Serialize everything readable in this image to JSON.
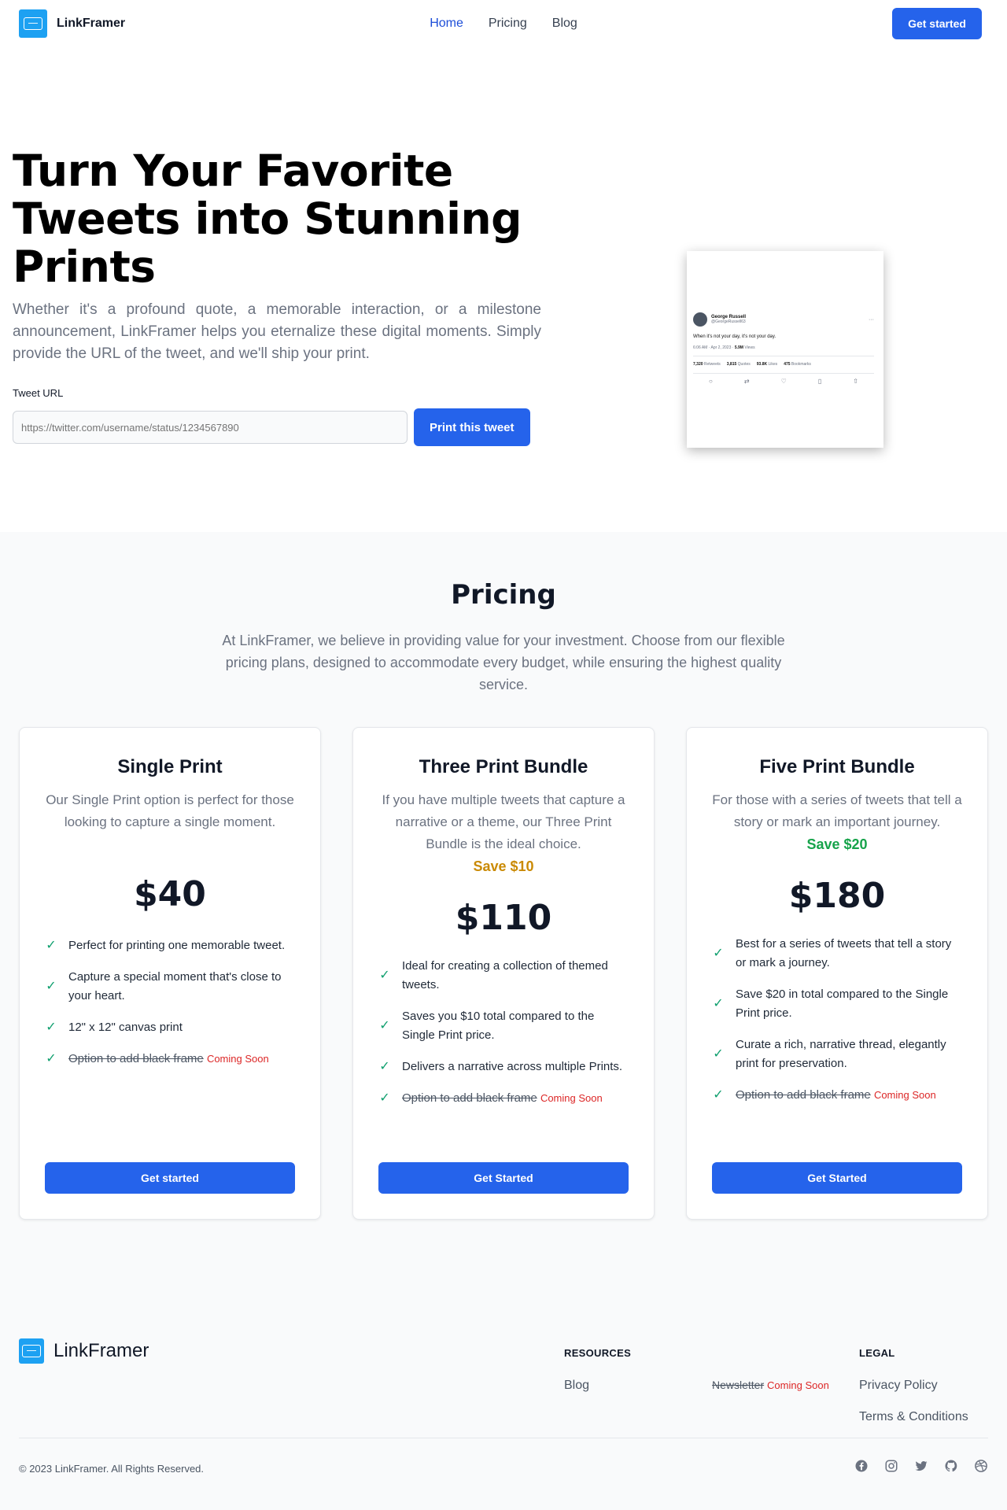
{
  "nav": {
    "brand": "LinkFramer",
    "links": [
      "Home",
      "Pricing",
      "Blog"
    ],
    "cta": "Get started"
  },
  "hero": {
    "title": "Turn Your Favorite Tweets into Stunning Prints",
    "description": "Whether it's a profound quote, a memorable interaction, or a milestone announcement, LinkFramer helps you eternalize these digital moments. Simply provide the URL of the tweet, and we'll ship your print.",
    "url_label": "Tweet URL",
    "url_placeholder": "https://twitter.com/username/status/1234567890",
    "button": "Print this tweet"
  },
  "tweet": {
    "name": "George Russell",
    "handle": "@GeorgeRussell63",
    "text": "When it's not your day, it's not your day.",
    "time": "6:06 AM · Apr 2, 2023 · ",
    "views_num": "5.9M",
    "views_label": " Views",
    "stats": [
      {
        "num": "7,320",
        "label": " Retweets"
      },
      {
        "num": "3,815",
        "label": " Quotes"
      },
      {
        "num": "93.8K",
        "label": " Likes"
      },
      {
        "num": "475",
        "label": " Bookmarks"
      }
    ]
  },
  "pricing": {
    "title": "Pricing",
    "description": "At LinkFramer, we believe in providing value for your investment. Choose from our flexible pricing plans, designed to accommodate every budget, while ensuring the highest quality service.",
    "plans": [
      {
        "name": "Single Print",
        "description": "Our Single Print option is perfect for those looking to capture a single moment.",
        "save": "",
        "price": "$40",
        "features": [
          "Perfect for printing one memorable tweet.",
          "Capture a special moment that's close to your heart.",
          "12\" x 12\" canvas print"
        ],
        "strike_feature": "Option to add black frame",
        "coming_soon": "Coming Soon",
        "button": "Get started"
      },
      {
        "name": "Three Print Bundle",
        "description": "If you have multiple tweets that capture a narrative or a theme, our Three Print Bundle is the ideal choice.",
        "save": "Save $10",
        "price": "$110",
        "features": [
          "Ideal for creating a collection of themed tweets.",
          "Saves you $10 total compared to the Single Print price.",
          "Delivers a narrative across multiple Prints."
        ],
        "strike_feature": "Option to add black frame",
        "coming_soon": "Coming Soon",
        "button": "Get Started"
      },
      {
        "name": "Five Print Bundle",
        "description": "For those with a series of tweets that tell a story or mark an important journey.",
        "save": "Save $20",
        "price": "$180",
        "features": [
          "Best for a series of tweets that tell a story or mark a journey.",
          "Save $20 in total compared to the Single Print price.",
          "Curate a rich, narrative thread, elegantly print for preservation."
        ],
        "strike_feature": "Option to add black frame",
        "coming_soon": "Coming Soon",
        "button": "Get Started"
      }
    ]
  },
  "footer": {
    "brand": "LinkFramer",
    "resources_title": "RESOURCES",
    "blog": "Blog",
    "newsletter": "Newsletter",
    "newsletter_soon": "Coming Soon",
    "legal_title": "LEGAL",
    "privacy": "Privacy Policy",
    "terms": "Terms & Conditions",
    "copyright": "© 2023 LinkFramer. All Rights Reserved.",
    "socials": [
      "facebook-icon",
      "instagram-icon",
      "twitter-icon",
      "github-icon",
      "dribbble-icon"
    ]
  },
  "colors": {
    "primary": "#2563eb",
    "brand_logo": "#1da1f2",
    "save_gold": "#ca8a04",
    "save_green": "#16a34a",
    "coming_soon": "#dc2626",
    "check": "#0f9f6e"
  }
}
